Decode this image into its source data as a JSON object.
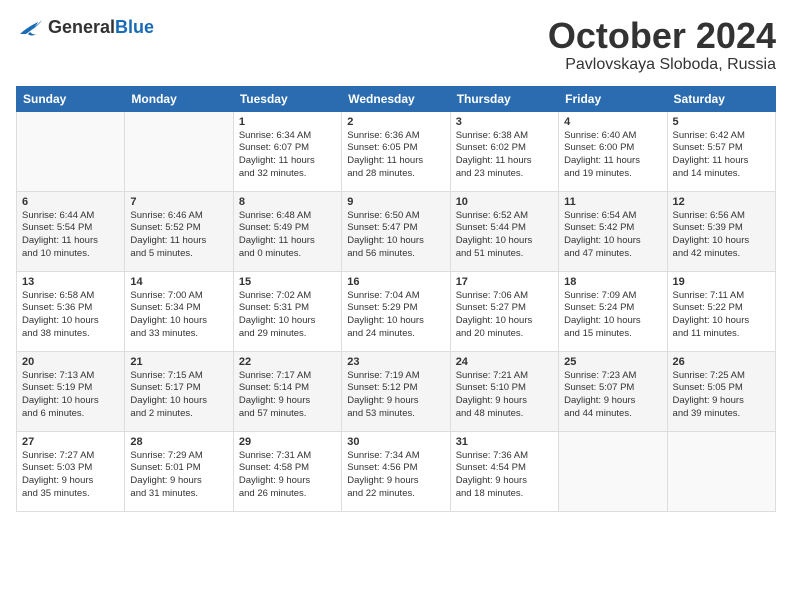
{
  "logo": {
    "general": "General",
    "blue": "Blue"
  },
  "title": "October 2024",
  "location": "Pavlovskaya Sloboda, Russia",
  "weekdays": [
    "Sunday",
    "Monday",
    "Tuesday",
    "Wednesday",
    "Thursday",
    "Friday",
    "Saturday"
  ],
  "weeks": [
    [
      {
        "num": "",
        "info": ""
      },
      {
        "num": "",
        "info": ""
      },
      {
        "num": "1",
        "info": "Sunrise: 6:34 AM\nSunset: 6:07 PM\nDaylight: 11 hours\nand 32 minutes."
      },
      {
        "num": "2",
        "info": "Sunrise: 6:36 AM\nSunset: 6:05 PM\nDaylight: 11 hours\nand 28 minutes."
      },
      {
        "num": "3",
        "info": "Sunrise: 6:38 AM\nSunset: 6:02 PM\nDaylight: 11 hours\nand 23 minutes."
      },
      {
        "num": "4",
        "info": "Sunrise: 6:40 AM\nSunset: 6:00 PM\nDaylight: 11 hours\nand 19 minutes."
      },
      {
        "num": "5",
        "info": "Sunrise: 6:42 AM\nSunset: 5:57 PM\nDaylight: 11 hours\nand 14 minutes."
      }
    ],
    [
      {
        "num": "6",
        "info": "Sunrise: 6:44 AM\nSunset: 5:54 PM\nDaylight: 11 hours\nand 10 minutes."
      },
      {
        "num": "7",
        "info": "Sunrise: 6:46 AM\nSunset: 5:52 PM\nDaylight: 11 hours\nand 5 minutes."
      },
      {
        "num": "8",
        "info": "Sunrise: 6:48 AM\nSunset: 5:49 PM\nDaylight: 11 hours\nand 0 minutes."
      },
      {
        "num": "9",
        "info": "Sunrise: 6:50 AM\nSunset: 5:47 PM\nDaylight: 10 hours\nand 56 minutes."
      },
      {
        "num": "10",
        "info": "Sunrise: 6:52 AM\nSunset: 5:44 PM\nDaylight: 10 hours\nand 51 minutes."
      },
      {
        "num": "11",
        "info": "Sunrise: 6:54 AM\nSunset: 5:42 PM\nDaylight: 10 hours\nand 47 minutes."
      },
      {
        "num": "12",
        "info": "Sunrise: 6:56 AM\nSunset: 5:39 PM\nDaylight: 10 hours\nand 42 minutes."
      }
    ],
    [
      {
        "num": "13",
        "info": "Sunrise: 6:58 AM\nSunset: 5:36 PM\nDaylight: 10 hours\nand 38 minutes."
      },
      {
        "num": "14",
        "info": "Sunrise: 7:00 AM\nSunset: 5:34 PM\nDaylight: 10 hours\nand 33 minutes."
      },
      {
        "num": "15",
        "info": "Sunrise: 7:02 AM\nSunset: 5:31 PM\nDaylight: 10 hours\nand 29 minutes."
      },
      {
        "num": "16",
        "info": "Sunrise: 7:04 AM\nSunset: 5:29 PM\nDaylight: 10 hours\nand 24 minutes."
      },
      {
        "num": "17",
        "info": "Sunrise: 7:06 AM\nSunset: 5:27 PM\nDaylight: 10 hours\nand 20 minutes."
      },
      {
        "num": "18",
        "info": "Sunrise: 7:09 AM\nSunset: 5:24 PM\nDaylight: 10 hours\nand 15 minutes."
      },
      {
        "num": "19",
        "info": "Sunrise: 7:11 AM\nSunset: 5:22 PM\nDaylight: 10 hours\nand 11 minutes."
      }
    ],
    [
      {
        "num": "20",
        "info": "Sunrise: 7:13 AM\nSunset: 5:19 PM\nDaylight: 10 hours\nand 6 minutes."
      },
      {
        "num": "21",
        "info": "Sunrise: 7:15 AM\nSunset: 5:17 PM\nDaylight: 10 hours\nand 2 minutes."
      },
      {
        "num": "22",
        "info": "Sunrise: 7:17 AM\nSunset: 5:14 PM\nDaylight: 9 hours\nand 57 minutes."
      },
      {
        "num": "23",
        "info": "Sunrise: 7:19 AM\nSunset: 5:12 PM\nDaylight: 9 hours\nand 53 minutes."
      },
      {
        "num": "24",
        "info": "Sunrise: 7:21 AM\nSunset: 5:10 PM\nDaylight: 9 hours\nand 48 minutes."
      },
      {
        "num": "25",
        "info": "Sunrise: 7:23 AM\nSunset: 5:07 PM\nDaylight: 9 hours\nand 44 minutes."
      },
      {
        "num": "26",
        "info": "Sunrise: 7:25 AM\nSunset: 5:05 PM\nDaylight: 9 hours\nand 39 minutes."
      }
    ],
    [
      {
        "num": "27",
        "info": "Sunrise: 7:27 AM\nSunset: 5:03 PM\nDaylight: 9 hours\nand 35 minutes."
      },
      {
        "num": "28",
        "info": "Sunrise: 7:29 AM\nSunset: 5:01 PM\nDaylight: 9 hours\nand 31 minutes."
      },
      {
        "num": "29",
        "info": "Sunrise: 7:31 AM\nSunset: 4:58 PM\nDaylight: 9 hours\nand 26 minutes."
      },
      {
        "num": "30",
        "info": "Sunrise: 7:34 AM\nSunset: 4:56 PM\nDaylight: 9 hours\nand 22 minutes."
      },
      {
        "num": "31",
        "info": "Sunrise: 7:36 AM\nSunset: 4:54 PM\nDaylight: 9 hours\nand 18 minutes."
      },
      {
        "num": "",
        "info": ""
      },
      {
        "num": "",
        "info": ""
      }
    ]
  ]
}
